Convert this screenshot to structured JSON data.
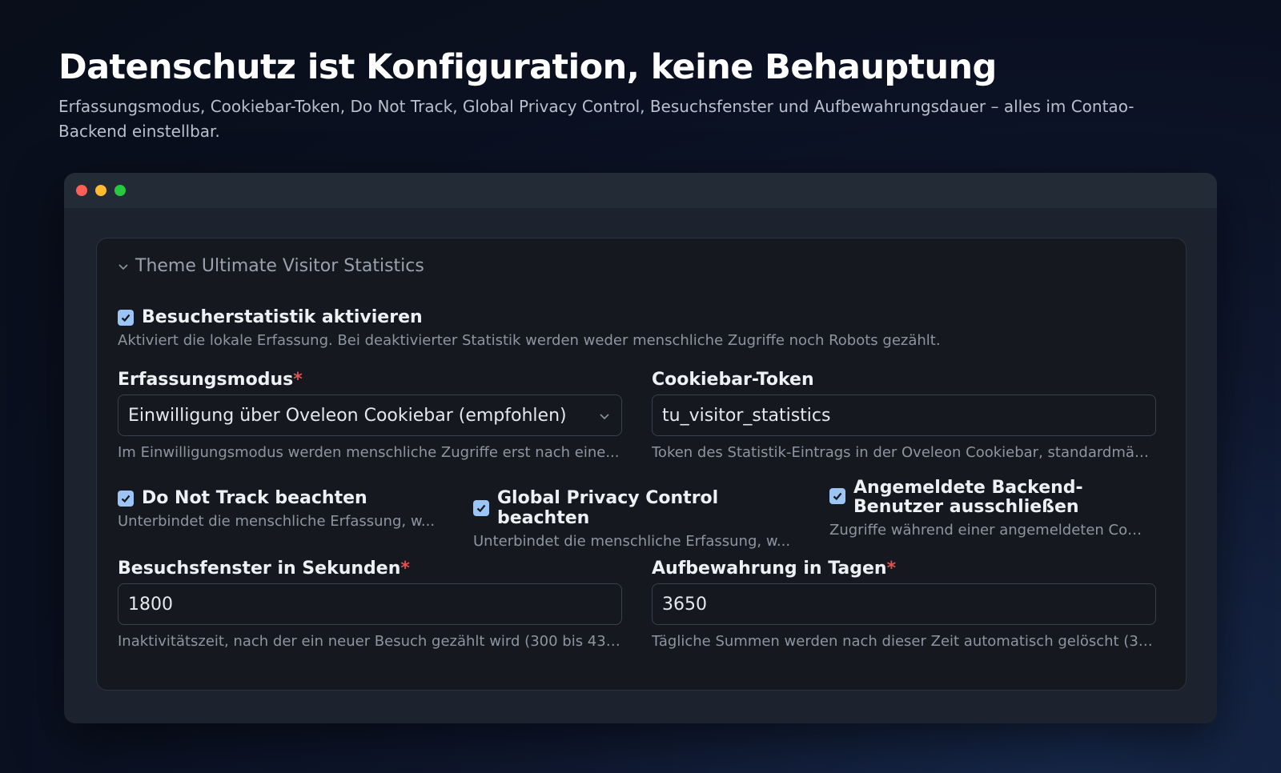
{
  "hero": {
    "title": "Datenschutz ist Konfiguration, keine Behauptung",
    "subtitle": "Erfassungsmodus, Cookiebar-Token, Do Not Track, Global Privacy Control, Besuchsfenster und Aufbewahrungsdauer – alles im Contao-Backend einstellbar."
  },
  "window": {
    "traffic_lights": [
      "#ff5f57",
      "#febc2e",
      "#28c840"
    ]
  },
  "panel": {
    "legend": "Theme Ultimate Visitor Statistics",
    "enable": {
      "label": "Besucherstatistik aktivieren",
      "checked": true,
      "help": "Aktiviert die lokale Erfassung. Bei deaktivierter Statistik werden weder menschliche Zugriffe noch Robots gezählt."
    },
    "mode": {
      "label": "Erfassungsmodus",
      "required_mark": "*",
      "value": "Einwilligung über Oveleon Cookiebar (empfohlen)",
      "help": "Im Einwilligungsmodus werden menschliche Zugriffe erst nach eine..."
    },
    "token": {
      "label": "Cookiebar-Token",
      "value": "tu_visitor_statistics",
      "help": "Token des Statistik-Eintrags in der Oveleon Cookiebar, standardmäß..."
    },
    "dnt": {
      "label": "Do Not Track beachten",
      "checked": true,
      "help": "Unterbindet die menschliche Erfassung, w..."
    },
    "gpc": {
      "label": "Global Privacy Control beachten",
      "checked": true,
      "help": "Unterbindet die menschliche Erfassung, w..."
    },
    "backend": {
      "label": "Angemeldete Backend-Benutzer ausschließen",
      "checked": true,
      "help": "Zugriffe während einer angemeldeten Con..."
    },
    "window_secs": {
      "label": "Besuchsfenster in Sekunden",
      "required_mark": "*",
      "value": "1800",
      "help": "Inaktivitätszeit, nach der ein neuer Besuch gezählt wird (300 bis 43...."
    },
    "retention": {
      "label": "Aufbewahrung in Tagen",
      "required_mark": "*",
      "value": "3650",
      "help": "Tägliche Summen werden nach dieser Zeit automatisch gelöscht (30..."
    }
  },
  "colors": {
    "checkbox": "#9cc4f4",
    "required": "#e05252"
  }
}
